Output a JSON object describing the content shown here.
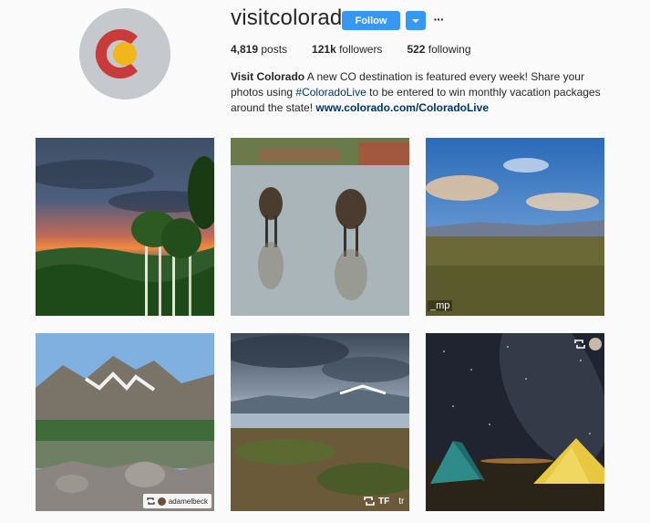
{
  "profile": {
    "username": "visitcolorado",
    "follow_label": "Follow",
    "more_label": "···"
  },
  "stats": {
    "posts_value": "4,819",
    "posts_label": " posts",
    "followers_value": "121k",
    "followers_label": " followers",
    "following_value": "522",
    "following_label": " following"
  },
  "bio": {
    "name": "Visit Colorado",
    "text_1": " A new CO destination is featured every week! Share your photos using ",
    "hashtag": "#ColoradoLive",
    "text_2": " to be entered to win monthly vacation packages around the state! ",
    "link": "www.colorado.com/ColoradoLive"
  },
  "posts": [
    {
      "id": "post-1",
      "desc": "sunset-aspen-forest"
    },
    {
      "id": "post-2",
      "desc": "moose-in-lake"
    },
    {
      "id": "post-3",
      "desc": "meadow-blue-sky",
      "overlay": "_mp"
    },
    {
      "id": "post-4",
      "desc": "alpine-lake-peaks",
      "credit": "adamelbeck"
    },
    {
      "id": "post-5",
      "desc": "lake-valley-clouds",
      "credit_text": "TF",
      "credit_text2": "tr"
    },
    {
      "id": "post-6",
      "desc": "tents-milky-way"
    }
  ],
  "colors": {
    "accent": "#3897f0",
    "link": "#003569",
    "background": "#fafafa"
  }
}
